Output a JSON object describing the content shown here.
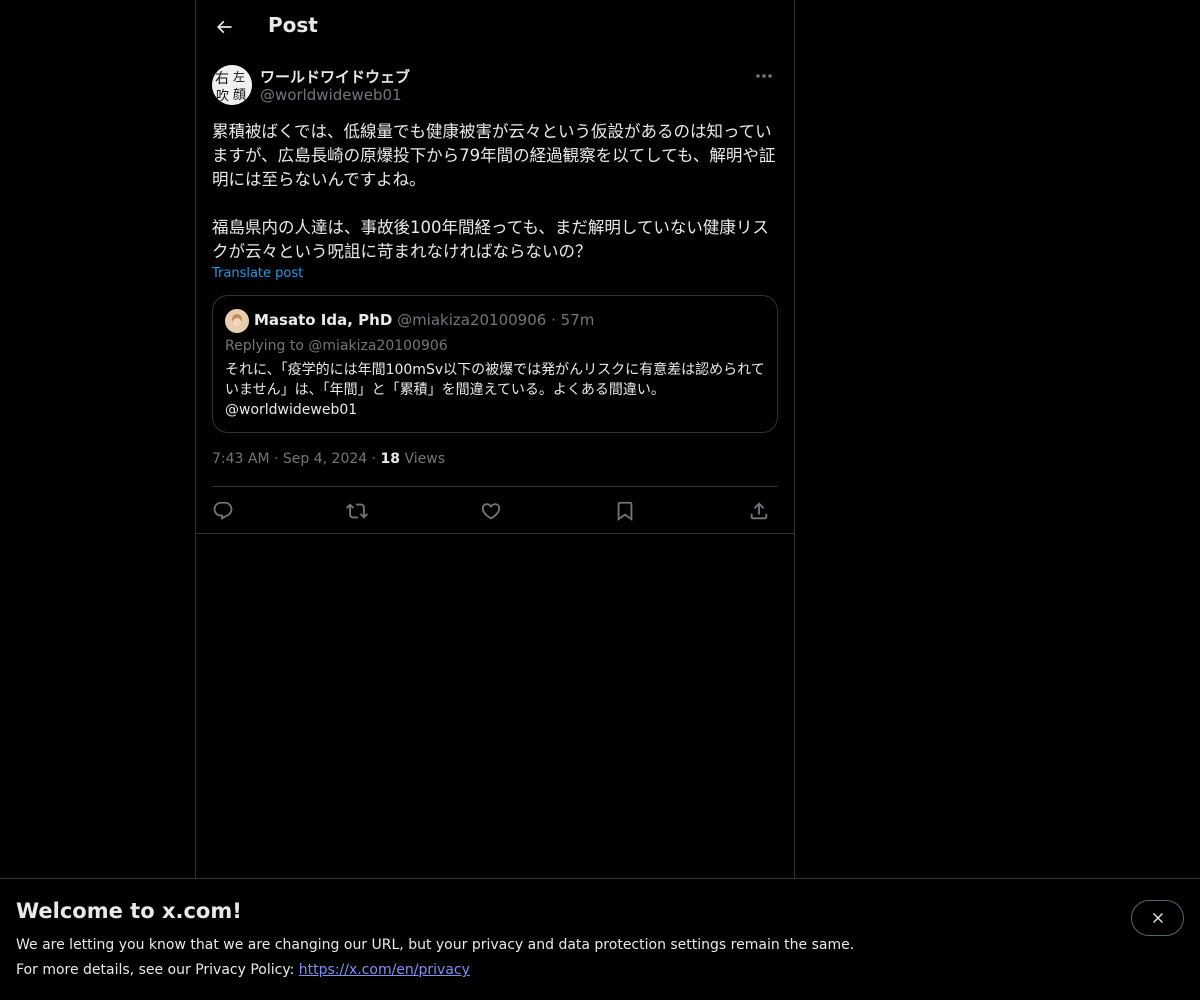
{
  "header": {
    "title": "Post"
  },
  "author": {
    "name": "ワールドワイドウェブ",
    "handle": "@worldwideweb01",
    "avatar_text": "右左吹顔"
  },
  "post": {
    "text": "累積被ばくでは、低線量でも健康被害が云々という仮設があるのは知っていますが、広島長崎の原爆投下から79年間の経過観察を以てしても、解明や証明には至らないんですよね。\n\n福島県内の人達は、事故後100年間経っても、まだ解明していない健康リスクが云々という呪詛に苛まれなければならないの？",
    "translate_label": "Translate post"
  },
  "quote": {
    "name": "Masato Ida, PhD",
    "handle": "@miakiza20100906",
    "separator": "·",
    "time": "57m",
    "replying": "Replying to @miakiza20100906",
    "text": "それに、「疫学的には年間100mSv以下の被爆では発がんリスクに有意差は認められていません」は、「年間」と「累積」を間違えている。よくある間違い。\n@worldwideweb01"
  },
  "meta": {
    "time": "7:43 AM",
    "date": "Sep 4, 2024",
    "separator": "·",
    "views_count": "18",
    "views_label": "Views"
  },
  "banner": {
    "title": "Welcome to x.com!",
    "line1": "We are letting you know that we are changing our URL, but your privacy and data protection settings remain the same.",
    "line2_prefix": "For more details, see our Privacy Policy: ",
    "link": "https://x.com/en/privacy"
  },
  "colors": {
    "background": "#000000",
    "text": "#e7e9ea",
    "muted": "#71767b",
    "accent": "#1d9bf0",
    "border": "#2f3336",
    "link": "#7f8ff4"
  },
  "icons": [
    "back-arrow-icon",
    "more-icon",
    "reply-icon",
    "repost-icon",
    "like-icon",
    "bookmark-icon",
    "share-icon",
    "close-icon"
  ]
}
